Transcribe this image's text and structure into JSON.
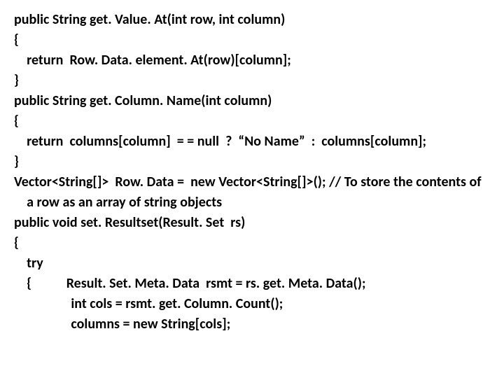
{
  "code": {
    "l1": "public String get. Value. At(int row, int column)",
    "l2": "{",
    "l3": "    return  Row. Data. element. At(row)[column];",
    "l4": "}",
    "l5": "public String get. Column. Name(int column)",
    "l6": "{",
    "l7": "    return  columns[column]  = = null  ?  “No Name”  :  columns[column];",
    "l8": "}",
    "l9": "Vector<String[]>  Row. Data =  new Vector<String[]>(); // To store the contents of",
    "l10": "    a row as an array of string objects",
    "l11": "public void set. Resultset(Result. Set  rs)",
    "l12": "{",
    "l13": "    try",
    "l14": "    {           Result. Set. Meta. Data  rsmt = rs. get. Meta. Data();",
    "l15": "                  int cols = rsmt. get. Column. Count();",
    "l16": "                  columns = new String[cols];"
  }
}
